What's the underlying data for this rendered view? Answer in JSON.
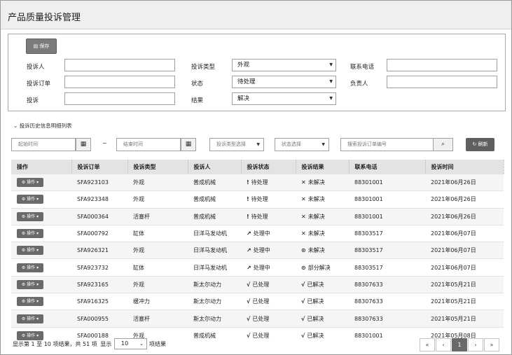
{
  "page": {
    "title": "产品质量投诉管理"
  },
  "form": {
    "save_label": "保存",
    "labels": {
      "complainant": "投诉人",
      "complaint_type": "投诉类型",
      "contact_phone": "联系电话",
      "complaint_order": "投诉订单",
      "status": "状态",
      "owner": "负责人",
      "complaint": "投诉",
      "result": "结果"
    },
    "values": {
      "complaint_type": "外观",
      "status": "待处理",
      "result": "解决"
    }
  },
  "history": {
    "title": "投诉历史信息明细列表",
    "start_placeholder": "起始时间",
    "tilde": "~",
    "end_placeholder": "结束时间",
    "type_select": "投诉类型选择",
    "status_select": "状态选择",
    "search_placeholder": "搜索投诉订单编号",
    "refresh_label": "刷新"
  },
  "table": {
    "headers": [
      "操作",
      "投诉订单",
      "投诉类型",
      "投诉人",
      "投诉状态",
      "投诉结果",
      "联系电话",
      "投诉时间"
    ],
    "op_label": "操作",
    "rows": [
      {
        "order": "SFA923103",
        "type": "外观",
        "person": "普成机械",
        "status_icon": "!",
        "status": "待处理",
        "result_icon": "✕",
        "result": "未解决",
        "phone": "88301001",
        "time": "2021年06月26日"
      },
      {
        "order": "SFA923348",
        "type": "外观",
        "person": "普成机械",
        "status_icon": "!",
        "status": "待处理",
        "result_icon": "✕",
        "result": "未解决",
        "phone": "88301001",
        "time": "2021年06月26日"
      },
      {
        "order": "SFA000364",
        "type": "活塞杆",
        "person": "普成机械",
        "status_icon": "!",
        "status": "待处理",
        "result_icon": "✕",
        "result": "未解决",
        "phone": "88301001",
        "time": "2021年06月26日"
      },
      {
        "order": "SFA000792",
        "type": "缸体",
        "person": "日洋马发动机",
        "status_icon": "↗",
        "status": "处理中",
        "result_icon": "✕",
        "result": "未解决",
        "phone": "88303517",
        "time": "2021年06月07日"
      },
      {
        "order": "SFA926321",
        "type": "外观",
        "person": "日洋马发动机",
        "status_icon": "↗",
        "status": "处理中",
        "result_icon": "⊙",
        "result": "未解决",
        "phone": "88303517",
        "time": "2021年06月07日"
      },
      {
        "order": "SFA923732",
        "type": "缸体",
        "person": "日洋马发动机",
        "status_icon": "↗",
        "status": "处理中",
        "result_icon": "⊙",
        "result": "部分解决",
        "phone": "88303517",
        "time": "2021年06月07日"
      },
      {
        "order": "SFA923165",
        "type": "外观",
        "person": "斯太尔动力",
        "status_icon": "√",
        "status": "已处理",
        "result_icon": "√",
        "result": "已解决",
        "phone": "88307633",
        "time": "2021年05月21日"
      },
      {
        "order": "SFA916325",
        "type": "缓冲力",
        "person": "斯太尔动力",
        "status_icon": "√",
        "status": "已处理",
        "result_icon": "√",
        "result": "已解决",
        "phone": "88307633",
        "time": "2021年05月21日"
      },
      {
        "order": "SFA000955",
        "type": "活塞杆",
        "person": "斯太尔动力",
        "status_icon": "√",
        "status": "已处理",
        "result_icon": "√",
        "result": "已解决",
        "phone": "88307633",
        "time": "2021年05月21日"
      },
      {
        "order": "SFA000188",
        "type": "外观",
        "person": "普成机械",
        "status_icon": "√",
        "status": "已处理",
        "result_icon": "√",
        "result": "已解决",
        "phone": "88301001",
        "time": "2021年05月08日"
      }
    ]
  },
  "footer": {
    "info": "显示第 1 至 10 项结果，共 51 项",
    "show_label": "显示",
    "page_size": "10",
    "items_label": "项结果",
    "pager": [
      "«",
      "‹",
      "1",
      "›",
      "»"
    ]
  },
  "colors": {
    "header_bg": "#efefef",
    "button_dark": "#6a6a6a",
    "active_page": "#6a6a6a"
  }
}
